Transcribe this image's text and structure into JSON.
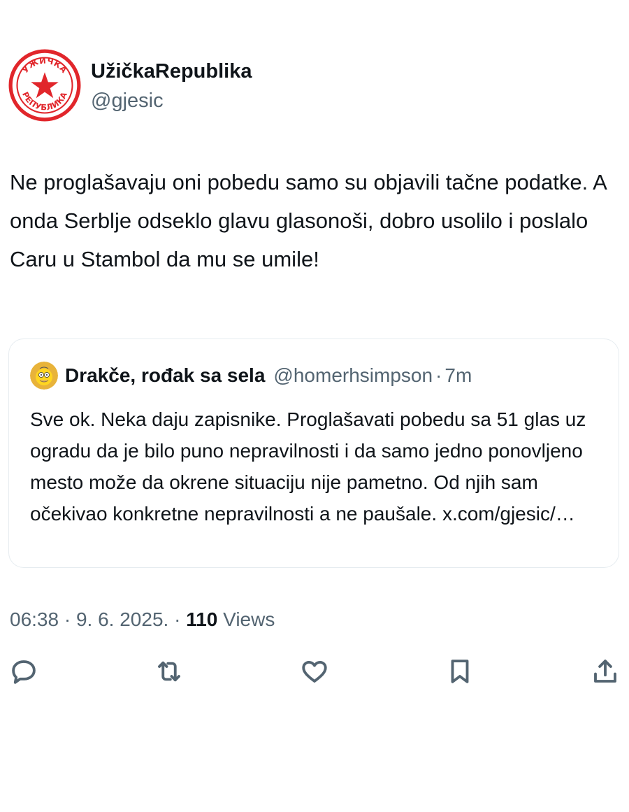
{
  "author": {
    "display_name": "UžičkaRepublika",
    "handle": "@gjesic",
    "avatar_icon": "red-star-emblem-icon",
    "avatar_text": "UŽIČKA REPUBLIKA"
  },
  "tweet": {
    "text": "Ne proglašavaju oni pobedu samo su objavili tačne podatke. A onda Serblje odseklo glavu glasonoši, dobro usolilo i poslalo Caru u Stambol da mu se umile!"
  },
  "quoted": {
    "display_name": "Drakče, rođak sa sela",
    "handle": "@homerhsimpson",
    "separator": "·",
    "time": "7m",
    "avatar_icon": "homer-avatar-icon",
    "text": "Sve ok. Neka daju zapisnike. Proglašavati pobedu sa 51 glas uz ogradu da je bilo puno nepravilnosti i da samo jedno ponovljeno mesto može da okrene situaciju nije pametno. Od njih sam očekivao konkretne nepravilnosti a ne paušale.",
    "link": "x.com/gjesic/…"
  },
  "meta": {
    "time": "06:38",
    "date": "9. 6. 2025.",
    "separator": "·",
    "views_count": "110",
    "views_label": "Views"
  },
  "actions": [
    {
      "name": "reply",
      "icon": "reply-icon"
    },
    {
      "name": "repost",
      "icon": "repost-icon"
    },
    {
      "name": "like",
      "icon": "heart-icon"
    },
    {
      "name": "bookmark",
      "icon": "bookmark-icon"
    },
    {
      "name": "share",
      "icon": "share-icon"
    }
  ],
  "colors": {
    "text_primary": "#0f1419",
    "text_secondary": "#536471",
    "border": "#e6ecf0",
    "avatar_red": "#e1262b",
    "avatar_yellow": "#ffd521"
  }
}
